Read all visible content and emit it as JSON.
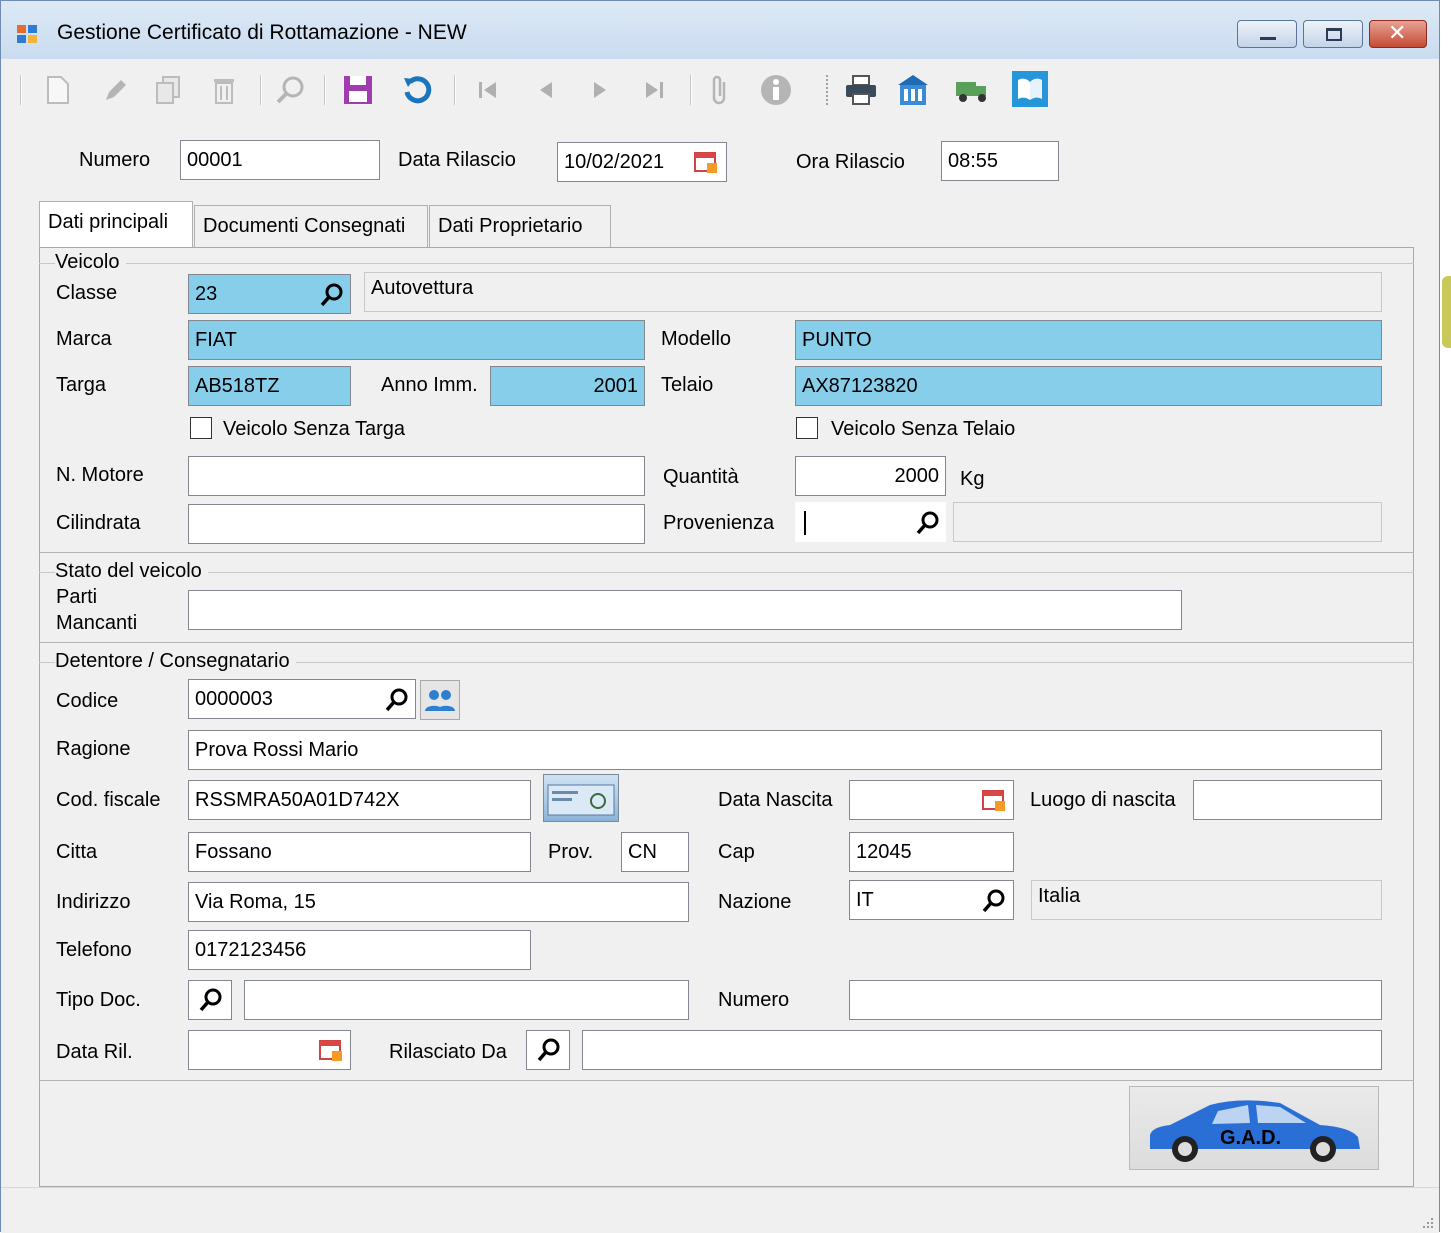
{
  "window": {
    "title": "Gestione Certificato di Rottamazione - NEW"
  },
  "toolbar": {
    "icons": [
      "new-icon",
      "edit-icon",
      "copy-icon",
      "delete-icon",
      "search-icon",
      "save-icon",
      "undo-icon",
      "first-icon",
      "previous-icon",
      "next-icon",
      "last-icon",
      "attachment-icon",
      "info-icon",
      "print-icon",
      "building-icon",
      "truck-icon",
      "book-icon"
    ]
  },
  "header": {
    "numero_label": "Numero",
    "numero_value": "00001",
    "data_rilascio_label": "Data Rilascio",
    "data_rilascio_value": "10/02/2021",
    "ora_rilascio_label": "Ora Rilascio",
    "ora_rilascio_value": "08:55"
  },
  "tabs": [
    {
      "label": "Dati principali"
    },
    {
      "label": "Documenti Consegnati"
    },
    {
      "label": "Dati Proprietario"
    }
  ],
  "veicolo": {
    "group_title": "Veicolo",
    "classe_label": "Classe",
    "classe_value": "23",
    "classe_desc": "Autovettura",
    "marca_label": "Marca",
    "marca_value": "FIAT",
    "modello_label": "Modello",
    "modello_value": "PUNTO",
    "targa_label": "Targa",
    "targa_value": "AB518TZ",
    "anno_label": "Anno Imm.",
    "anno_value": "2001",
    "telaio_label": "Telaio",
    "telaio_value": "AX87123820",
    "senza_targa_label": "Veicolo Senza Targa",
    "senza_telaio_label": "Veicolo Senza Telaio",
    "motore_label": "N. Motore",
    "motore_value": "",
    "quantita_label": "Quantità",
    "quantita_value": "2000",
    "quantita_unit": "Kg",
    "cilindrata_label": "Cilindrata",
    "cilindrata_value": "",
    "provenienza_label": "Provenienza",
    "provenienza_value": ""
  },
  "stato": {
    "group_title": "Stato del veicolo",
    "parti_label_1": "Parti",
    "parti_label_2": "Mancanti",
    "parti_value": ""
  },
  "detentore": {
    "group_title": "Detentore / Consegnatario",
    "codice_label": "Codice",
    "codice_value": "0000003",
    "ragione_label": "Ragione",
    "ragione_value": "Prova Rossi Mario",
    "cf_label": "Cod. fiscale",
    "cf_value": "RSSMRA50A01D742X",
    "data_nascita_label": "Data Nascita",
    "data_nascita_value": "",
    "luogo_nascita_label": "Luogo di nascita",
    "luogo_nascita_value": "",
    "citta_label": "Citta",
    "citta_value": "Fossano",
    "prov_label": "Prov.",
    "prov_value": "CN",
    "cap_label": "Cap",
    "cap_value": "12045",
    "indirizzo_label": "Indirizzo",
    "indirizzo_value": "Via Roma, 15",
    "nazione_label": "Nazione",
    "nazione_value": "IT",
    "nazione_desc": "Italia",
    "telefono_label": "Telefono",
    "telefono_value": "0172123456",
    "tipo_doc_label": "Tipo Doc.",
    "tipo_doc_value": "",
    "numero_label": "Numero",
    "numero_value": "",
    "data_ril_label": "Data Ril.",
    "data_ril_value": "",
    "rilasciato_label": "Rilasciato Da",
    "rilasciato_value": ""
  },
  "gad_button": {
    "label": "G.A.D.",
    "color": "#2a6fd6"
  }
}
